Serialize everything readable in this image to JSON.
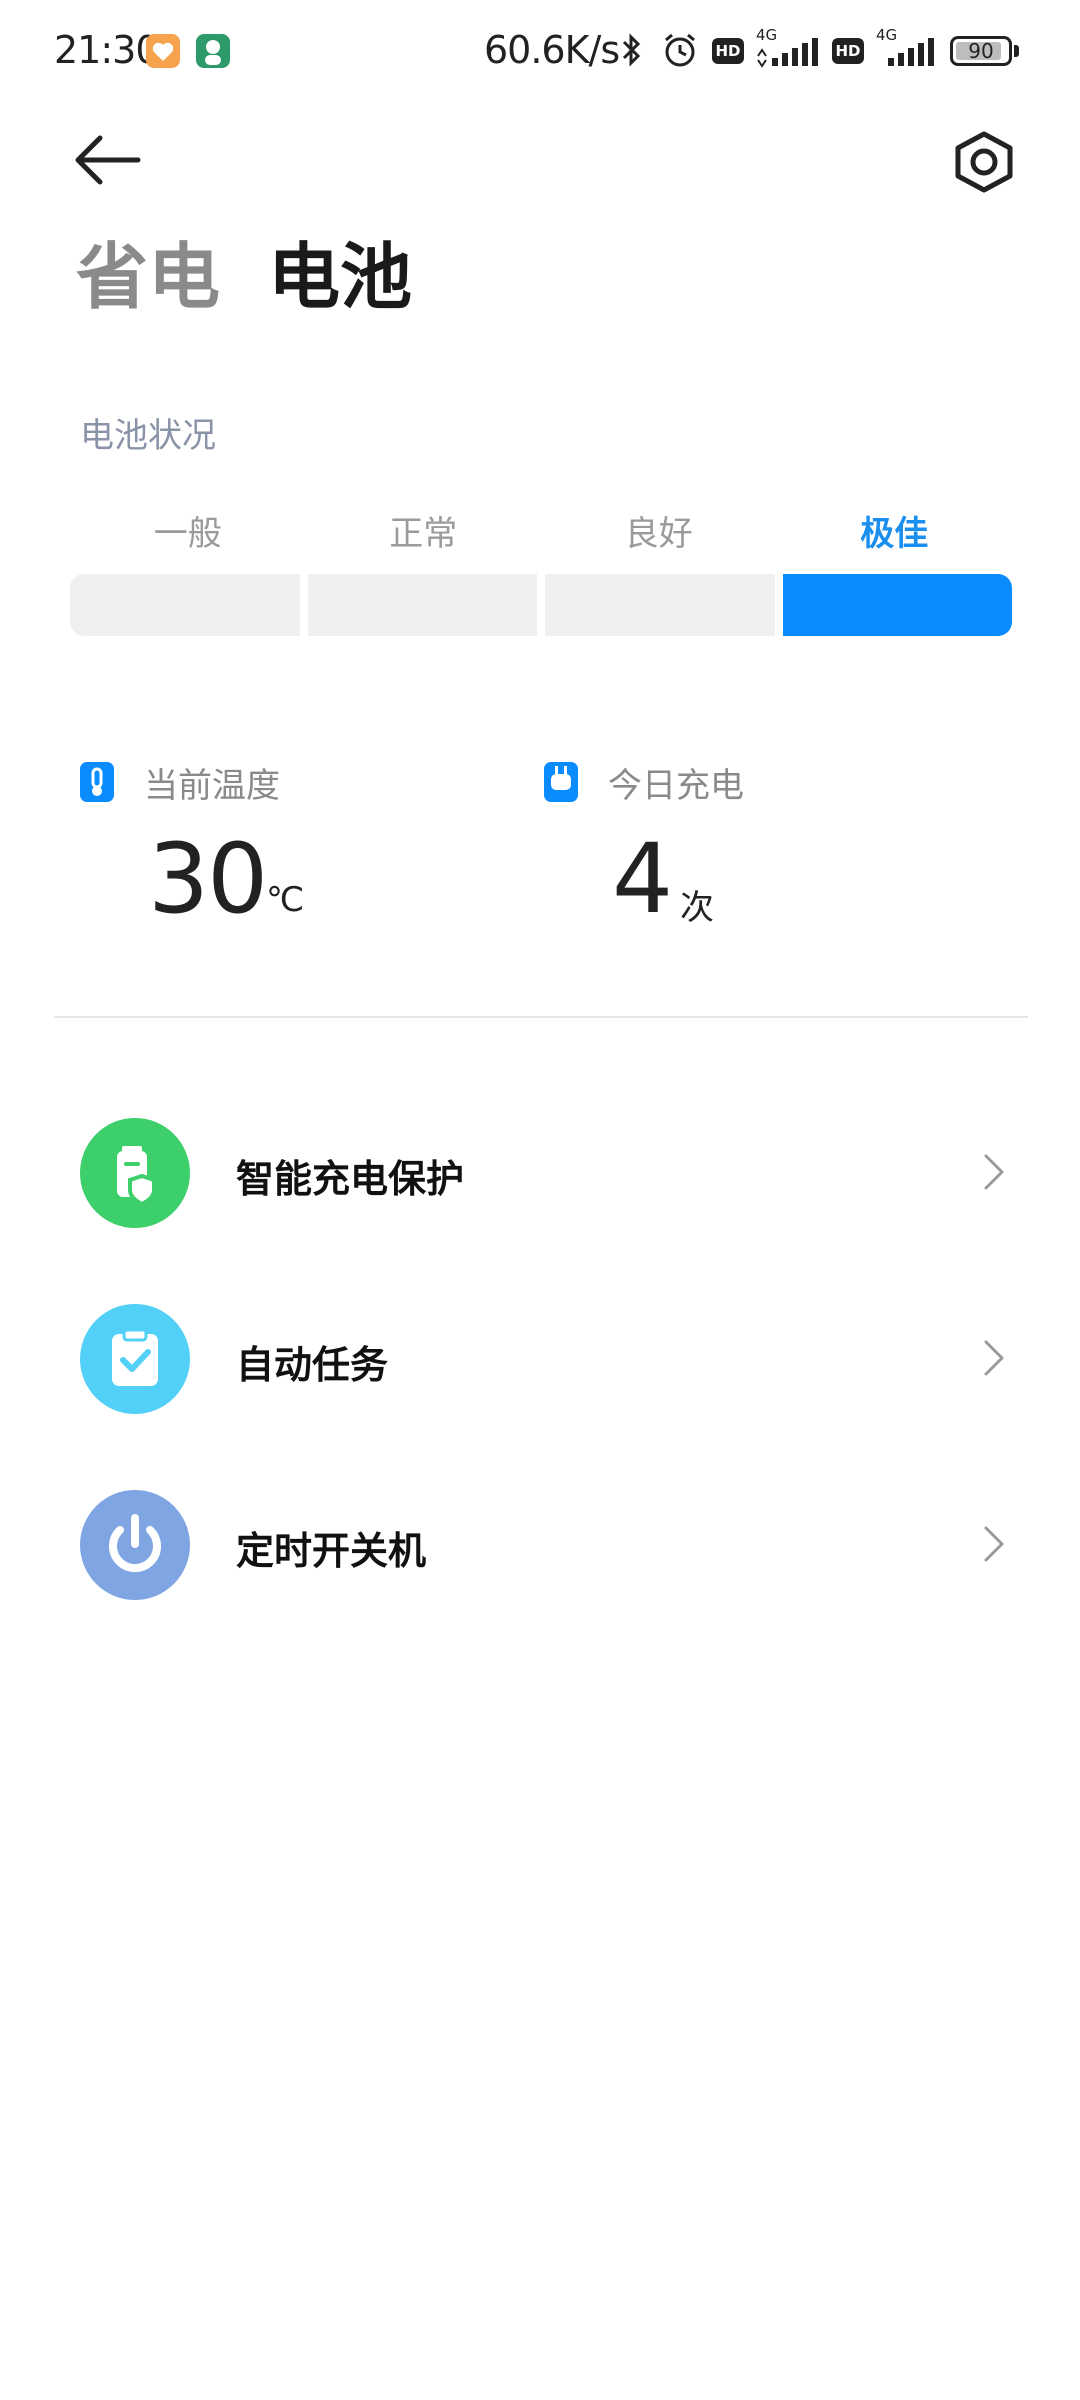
{
  "status_bar": {
    "time": "21:30",
    "net_speed": "60.6K/s",
    "hd_badge": "HD",
    "network_type": "4G",
    "battery_level_text": "90",
    "battery_fraction": 0.9,
    "icons": [
      "app-health-icon",
      "app-avatar-icon",
      "bluetooth-icon",
      "alarm-icon",
      "signal-icon"
    ]
  },
  "header": {
    "tabs": [
      {
        "label": "省电",
        "active": false
      },
      {
        "label": "电池",
        "active": true
      }
    ]
  },
  "battery_status": {
    "section_label": "电池状况",
    "levels": [
      {
        "label": "一般",
        "active": false
      },
      {
        "label": "正常",
        "active": false
      },
      {
        "label": "良好",
        "active": false
      },
      {
        "label": "极佳",
        "active": true
      }
    ],
    "accent_color": "#0a8cff"
  },
  "stats": {
    "temperature": {
      "label": "当前温度",
      "value": "30",
      "unit": "℃"
    },
    "charge_count": {
      "label": "今日充电",
      "value": "4",
      "unit": "次"
    }
  },
  "menu": {
    "items": [
      {
        "label": "智能充电保护",
        "icon": "battery-shield-icon",
        "color": "#3ccf6a"
      },
      {
        "label": "自动任务",
        "icon": "clipboard-check-icon",
        "color": "#52d0f7"
      },
      {
        "label": "定时开关机",
        "icon": "power-icon",
        "color": "#7fa6e3"
      }
    ]
  }
}
